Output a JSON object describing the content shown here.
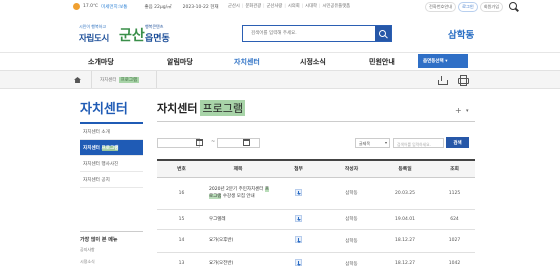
{
  "topbar": {
    "weather": "17.0℃",
    "air_quality": "미세먼지:보통",
    "air_detail": "좋음 22μg/㎥",
    "date": "2023-10-22 현재",
    "links": [
      "군산시",
      "문화관광",
      "군산사랑",
      "시의회",
      "시대학",
      "시민공유플랫폼"
    ],
    "chip_mobile": "전화번호안내",
    "chip_login": "로그인",
    "chip_join": "회원가입"
  },
  "header": {
    "logo_sub": "시민이 행복하고",
    "logo_main": "자립도시",
    "logo_brush": "군산",
    "logo_right_sub": "행복콘텐츠",
    "logo_right_main": "읍면동",
    "search_placeholder": "검색어를 입력해 주세요.",
    "dong_name": "삼학동"
  },
  "gnb": {
    "items": [
      "소개마당",
      "알림마당",
      "자치센터",
      "시정소식",
      "민원안내"
    ],
    "select_label": "읍면동선택 ▾"
  },
  "breadcrumb": {
    "label": "자치센터",
    "current": "프로그램"
  },
  "sidebar": {
    "title": "자치센터",
    "items": [
      "자치센터 소개",
      "자치센터 ",
      "자치센터 행사사진",
      "자치센터 공지"
    ],
    "active_suffix": "프로그램",
    "popular_title": "가장 많이 본 메뉴",
    "popular_items": [
      "공지사항",
      "시정소식"
    ]
  },
  "content": {
    "title_prefix": "자치센터",
    "title_highlight": "프로그램",
    "filter_select": "글제목",
    "filter_placeholder": "검색어를 입력하세요.",
    "search_button": "검색",
    "columns": [
      "번호",
      "제목",
      "첨부",
      "작성자",
      "등록일",
      "조회"
    ],
    "rows": [
      {
        "no": "16",
        "title_a": "2020년 2분기 주민자치센터 ",
        "title_hl": "프로그램",
        "title_b": " 수강생 모집 안내",
        "writer": "삼학동",
        "date": "20.03.25",
        "views": "1125"
      },
      {
        "no": "15",
        "title_a": "우그렐레",
        "title_hl": "",
        "title_b": "",
        "writer": "삼학동",
        "date": "19.04.01",
        "views": "624"
      },
      {
        "no": "14",
        "title_a": "요가(오후반)",
        "title_hl": "",
        "title_b": "",
        "writer": "삼학동",
        "date": "18.12.27",
        "views": "1027"
      },
      {
        "no": "13",
        "title_a": "요가(오전반)",
        "title_hl": "",
        "title_b": "",
        "writer": "삼학동",
        "date": "18.12.27",
        "views": "1042"
      }
    ]
  },
  "colors": {
    "brand_blue": "#1f5bb5",
    "highlight_green": "#a8d4a8"
  }
}
